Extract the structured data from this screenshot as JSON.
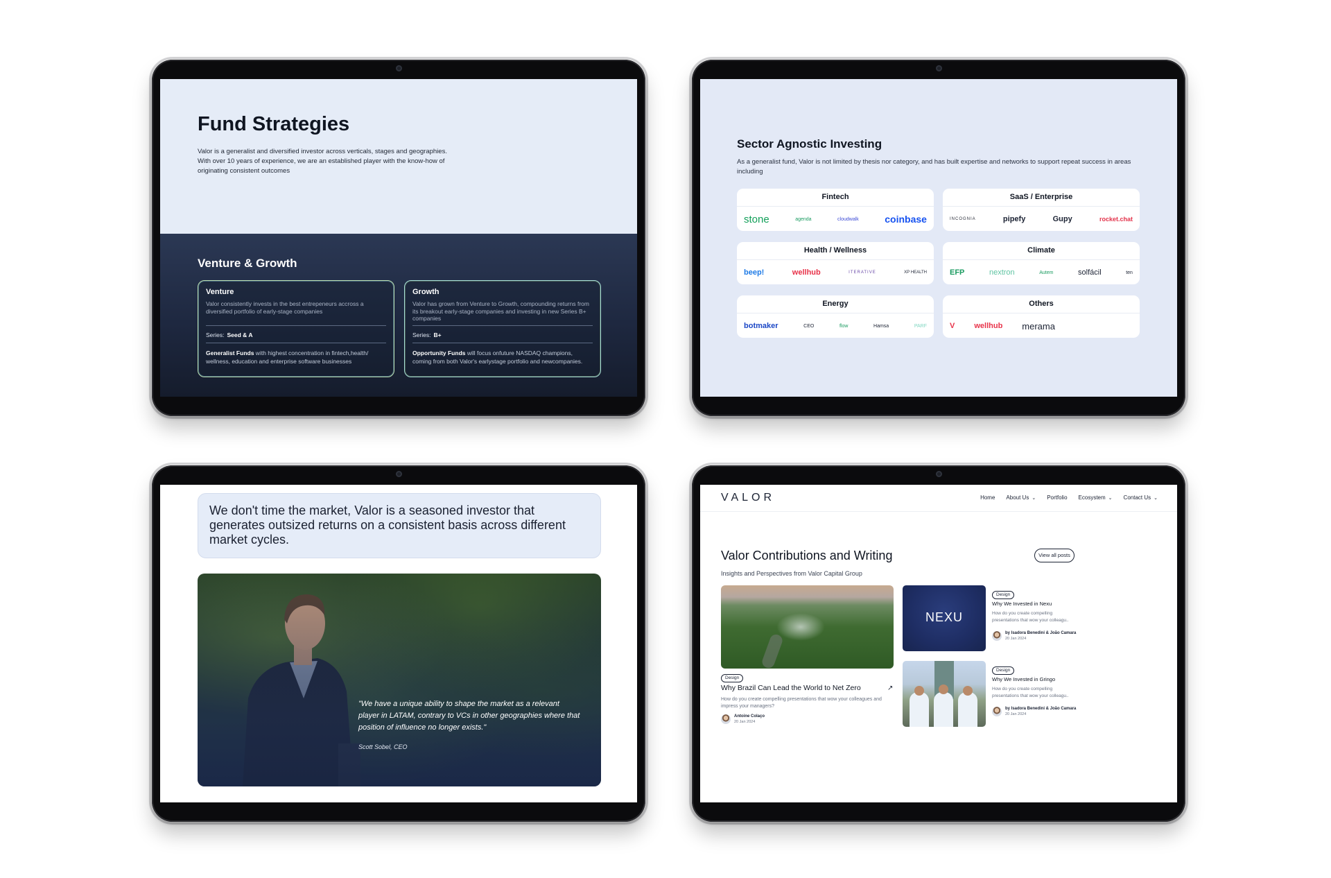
{
  "slide1": {
    "title": "Fund Strategies",
    "intro": "Valor is a generalist and diversified investor across verticals, stages and geographies. With over 10 years of experience, we are an established player with the know-how of originating consistent outcomes",
    "section_title": "Venture & Growth",
    "cards": [
      {
        "title": "Venture",
        "desc": "Valor consistently invests in the best entrepeneurs accross a diversified portfolio of early-stage companies",
        "series_label": "Series:",
        "series_value": "Seed & A",
        "fund_bold": "Generalist Funds",
        "fund_text": " with highest concentration in fintech,health/ wellness, education and enterprise software businesses"
      },
      {
        "title": "Growth",
        "desc": "Valor has grown from Venture to Growth, compounding returns from its breakout early-stage companies and investing in new Series B+ companies",
        "series_label": "Series:",
        "series_value": "B+",
        "fund_bold": "Opportunity Funds",
        "fund_text": " will focus onfuture NASDAQ champions, coming from both Valor's earlystage portfolio and newcompanies."
      }
    ]
  },
  "slide2": {
    "title": "Sector Agnostic Investing",
    "intro": "As a generalist fund, Valor is not limited by thesis nor category, and has built expertise and networks to support repeat success in areas including",
    "sectors": [
      {
        "name": "Fintech",
        "logos": [
          "stone",
          "agenda",
          "cloudwalk",
          "coinbase"
        ]
      },
      {
        "name": "SaaS / Enterprise",
        "logos": [
          "INCOGNIA",
          "pipefy",
          "Gupy",
          "rocket.chat"
        ]
      },
      {
        "name": "Health / Wellness",
        "logos": [
          "beep!",
          "wellhub",
          "ITERATIVE",
          "XP HEALTH"
        ]
      },
      {
        "name": "Climate",
        "logos": [
          "EFP",
          "nextron",
          "Autem",
          "solfácil",
          "ten"
        ]
      },
      {
        "name": "Energy",
        "logos": [
          "botmaker",
          "CEO",
          "flow",
          "Hamsa",
          "PARF"
        ]
      },
      {
        "name": "Others",
        "logos": [
          "V",
          "wellhub",
          "merama"
        ]
      }
    ],
    "colors": {
      "stone": "#14a05a",
      "coinbase": "#1652f0",
      "rocket": "#e3344c",
      "wellhub": "#e8334a",
      "beep": "#1f7be6",
      "green": "#1a9b60",
      "botmaker": "#1b47c6"
    }
  },
  "slide3": {
    "statement": "We don't time the market, Valor is a seasoned investor that generates outsized returns on a consistent basis across different market cycles.",
    "quote": "\"We have a  unique ability to shape the market as a relevant player in LATAM, contrary to VCs in other geographies where that position of influence no longer exists.\"",
    "quote_author": "Scott Sobel, CEO"
  },
  "slide4": {
    "brand": "VALOR",
    "nav": [
      {
        "label": "Home",
        "dropdown": ""
      },
      {
        "label": "About Us",
        "dropdown": "⌄"
      },
      {
        "label": "Portfolio",
        "dropdown": ""
      },
      {
        "label": "Ecosystem",
        "dropdown": "⌄"
      },
      {
        "label": "Contact Us",
        "dropdown": "⌄"
      }
    ],
    "title": "Valor Contributions and Writing",
    "subtitle": "Insights and Perspectives from Valor Capital Group",
    "view_all": "View all posts",
    "featured": {
      "tag": "Design",
      "title": "Why Brazil Can Lead the World to Net Zero",
      "arrow": "↗",
      "desc": "How do you create compelling presentations that wow your colleagues and impress your managers?",
      "author": "Antoine Colaço",
      "date": "20 Jan 2024"
    },
    "posts": [
      {
        "image_text": "NEXU",
        "tag": "Design",
        "title": "Why We Invested in Nexu",
        "desc": "How do you create compelling presentations that wow your colleagu..",
        "author": "by Isadora Benedini & João Camara",
        "date": "20 Jan 2024"
      },
      {
        "tag": "Design",
        "title": "Why We Invested in Gringo",
        "desc": "How do you create compelling presentations that wow your colleagu..",
        "author": "by Isadora Benedini & João Camara",
        "date": "20 Jan 2024"
      }
    ]
  }
}
